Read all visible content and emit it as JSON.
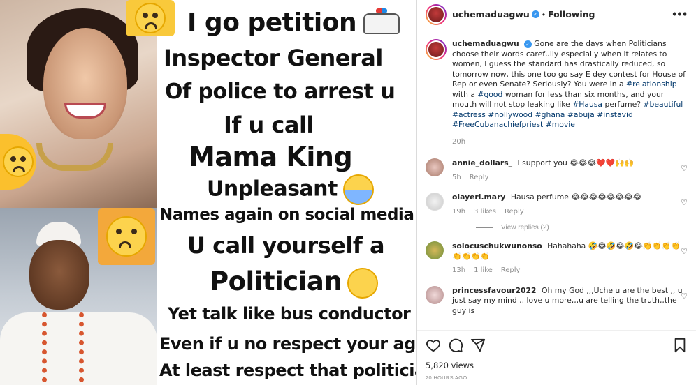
{
  "meme": {
    "lines": [
      "I go petition",
      "Inspector General",
      "Of police to arrest u",
      "If u call",
      "Mama King",
      "Unpleasant",
      "Names again on social media",
      "U call yourself a",
      "Politician",
      "Yet talk like bus conductor",
      "Even if u no respect your age",
      "At least respect that politician"
    ],
    "emoji_top": "crying-face",
    "emoji_left": "sad-face",
    "emoji_right": "eye-roll-face",
    "emoji_unpleasant": "loudly-crying-face",
    "emoji_politician": "rolling-on-floor-laughing",
    "emoji_petition": "police-car"
  },
  "header": {
    "username": "uchemaduagwu",
    "separator": "•",
    "follow_label": "Following",
    "more_icon": "more-horizontal-icon"
  },
  "caption": {
    "username": "uchemaduagwu",
    "text": "Gone are the days when Politicians choose their words carefully especially when it relates to women, I guess the standard has drastically reduced, so tomorrow now, this one too go say E dey contest for House of Rep or even Senate? Seriously? You were in a",
    "tag1": "#relationship",
    "mid1": "with a",
    "tag2": "#good",
    "mid2": "woman for less than six months, and your mouth will not stop leaking like",
    "tag3": "#Hausa",
    "mid3": "perfume?",
    "tags_rest": "#beautiful #actress #nollywood #ghana #abuja #instavid #FreeCubanachiefpriest #movie",
    "time": "20h"
  },
  "comments": [
    {
      "username": "annie_dollars_",
      "text": "I support you",
      "emojis": "😂😂😂❤️❤️🙌🙌",
      "time": "5h",
      "likes": "",
      "reply": "Reply"
    },
    {
      "username": "olayeri.mary",
      "text": "Hausa perfume",
      "emojis": "😂😂😂😂😂😂😂😂",
      "time": "19h",
      "likes": "3 likes",
      "reply": "Reply",
      "view_replies": "View replies (2)"
    },
    {
      "username": "solocuschukwunonso",
      "text": "Hahahaha",
      "emojis": "🤣😂🤣😂🤣😂👏👏👏👏👏👏👏👏",
      "time": "13h",
      "likes": "1 like",
      "reply": "Reply"
    },
    {
      "username": "princessfavour2022",
      "text": "Oh my God ,,,Uche u are the best ,, u just say my mind ,, love u more,,,u are telling the truth,,the guy is",
      "emojis": "",
      "time": "",
      "likes": "",
      "reply": ""
    }
  ],
  "footer": {
    "views": "5,820 views",
    "time": "20 HOURS AGO"
  },
  "icons": {
    "like": "heart-icon",
    "comment": "comment-icon",
    "share": "share-icon",
    "save": "bookmark-icon"
  },
  "colors": {
    "link": "#00376b",
    "verified": "#3897f0",
    "muted": "#8e8e8e"
  }
}
